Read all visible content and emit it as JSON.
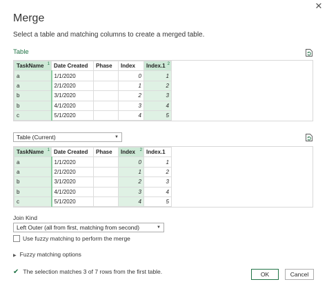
{
  "dialog": {
    "title": "Merge",
    "subtitle": "Select a table and matching columns to create a merged table.",
    "close_glyph": "✕"
  },
  "first_table": {
    "section_label": "Table",
    "columns": [
      {
        "label": "TaskName",
        "index": "1"
      },
      {
        "label": "Date Created",
        "index": ""
      },
      {
        "label": "Phase",
        "index": ""
      },
      {
        "label": "Index",
        "index": ""
      },
      {
        "label": "Index.1",
        "index": "2"
      }
    ],
    "rows": [
      [
        "a",
        "1/1/2020",
        "",
        "0",
        "1"
      ],
      [
        "a",
        "2/1/2020",
        "",
        "1",
        "2"
      ],
      [
        "b",
        "3/1/2020",
        "",
        "2",
        "3"
      ],
      [
        "b",
        "4/1/2020",
        "",
        "3",
        "4"
      ],
      [
        "c",
        "5/1/2020",
        "",
        "4",
        "5"
      ]
    ]
  },
  "second_table": {
    "selector_value": "Table (Current)",
    "columns": [
      {
        "label": "TaskName",
        "index": "1"
      },
      {
        "label": "Date Created",
        "index": ""
      },
      {
        "label": "Phase",
        "index": ""
      },
      {
        "label": "Index",
        "index": "2"
      },
      {
        "label": "Index.1",
        "index": ""
      }
    ],
    "rows": [
      [
        "a",
        "1/1/2020",
        "",
        "0",
        "1"
      ],
      [
        "a",
        "2/1/2020",
        "",
        "1",
        "2"
      ],
      [
        "b",
        "3/1/2020",
        "",
        "2",
        "3"
      ],
      [
        "b",
        "4/1/2020",
        "",
        "3",
        "4"
      ],
      [
        "c",
        "5/1/2020",
        "",
        "4",
        "5"
      ]
    ]
  },
  "join": {
    "label": "Join Kind",
    "selected": "Left Outer (all from first, matching from second)",
    "fuzzy_label": "Use fuzzy matching to perform the merge",
    "fuzzy_checked": false,
    "fuzzy_options_label": "Fuzzy matching options"
  },
  "status": {
    "message": "The selection matches 3 of 7 rows from the first table."
  },
  "buttons": {
    "ok": "OK",
    "cancel": "Cancel"
  },
  "colors": {
    "accent": "#217346",
    "selected_column": "#dff1e4"
  }
}
